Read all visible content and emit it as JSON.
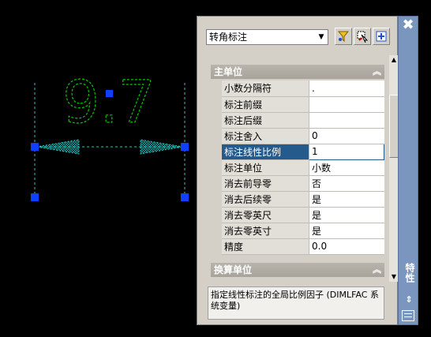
{
  "drawing": {
    "dimension_text": "9.7",
    "colors": {
      "background": "#000000",
      "text": "#00c800",
      "lines": "#20c8c8",
      "grips": "#1040ff"
    }
  },
  "palette": {
    "object_type": "转角标注",
    "title": "特性",
    "close_glyph": "✖",
    "autohide_glyph": "⇕",
    "sections": [
      {
        "label": "主单位",
        "rows": [
          {
            "name": "小数分隔符",
            "value": "."
          },
          {
            "name": "标注前缀",
            "value": ""
          },
          {
            "name": "标注后缀",
            "value": ""
          },
          {
            "name": "标注舍入",
            "value": "0"
          },
          {
            "name": "标注线性比例",
            "value": "1",
            "selected": true
          },
          {
            "name": "标注单位",
            "value": "小数"
          },
          {
            "name": "消去前导零",
            "value": "否"
          },
          {
            "name": "消去后续零",
            "value": "是"
          },
          {
            "name": "消去零英尺",
            "value": "是"
          },
          {
            "name": "消去零英寸",
            "value": "是"
          },
          {
            "name": "精度",
            "value": "0.0"
          }
        ]
      },
      {
        "label": "换算单位"
      }
    ],
    "description": "指定线性标注的全局比例因子 (DIMLFAC 系统变量)",
    "toolbar": [
      {
        "icon": "quick-select-icon"
      },
      {
        "icon": "select-objects-icon"
      },
      {
        "icon": "toggle-pickadd-icon"
      }
    ]
  }
}
